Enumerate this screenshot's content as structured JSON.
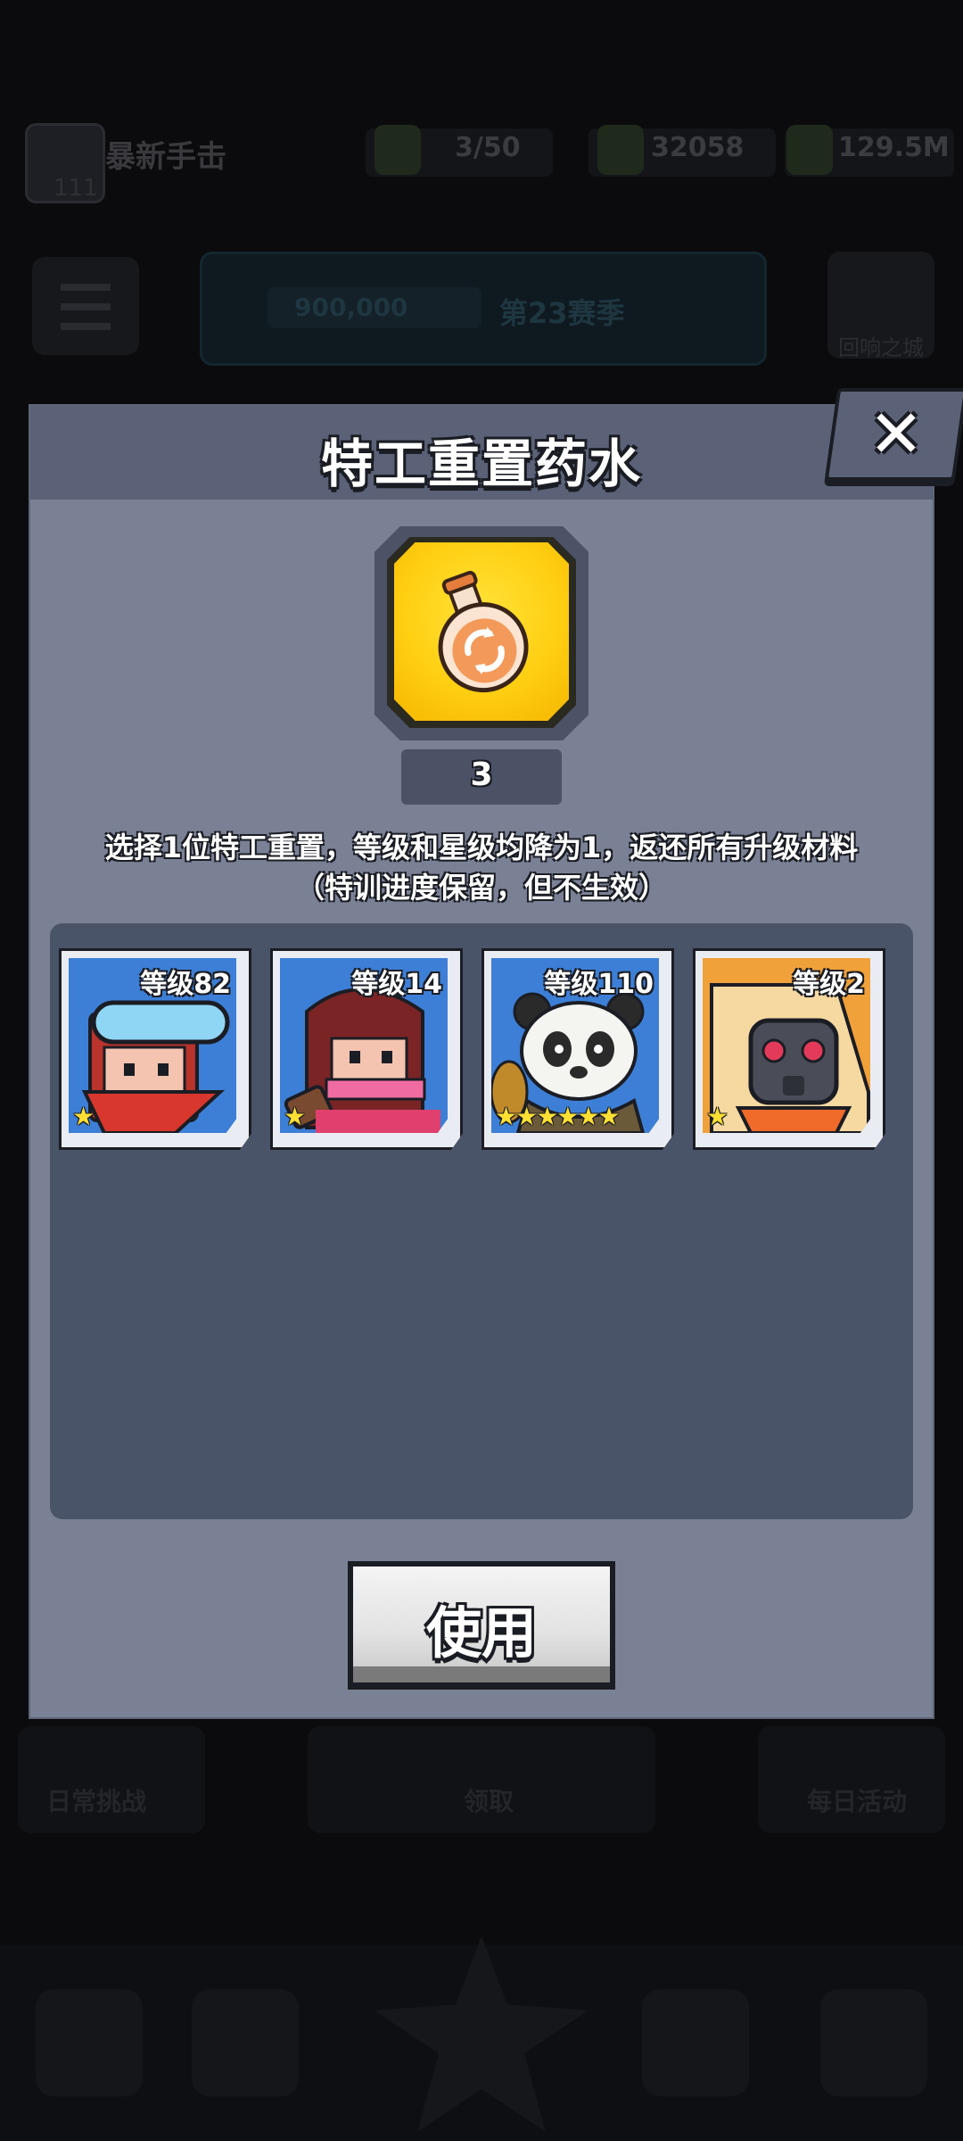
{
  "background": {
    "player_name": "暴新手击",
    "player_sub": "111",
    "res_stamina": "3/50",
    "res_gems": "32058",
    "res_gold": "129.5M",
    "banner_chip": "900,000",
    "banner_text": "第23赛季",
    "shield_label": "回响之城",
    "lower_left_label": "日常挑战",
    "lower_center_label": "领取",
    "lower_right_label": "每日活动"
  },
  "modal": {
    "title": "特工重置药水",
    "item_icon": "reset-potion-icon",
    "item_count": "3",
    "description_line1": "选择1位特工重置，等级和星级均降为1，返还所有升级材料",
    "description_line2": "（特训进度保留，但不生效）",
    "use_label": "使用",
    "close_icon": "close-icon"
  },
  "agents": [
    {
      "level": "等级82",
      "stars": 1,
      "portrait": "goggles-ninja-portrait"
    },
    {
      "level": "等级14",
      "stars": 1,
      "portrait": "red-hair-girl-portrait"
    },
    {
      "level": "等级110",
      "stars": 6,
      "portrait": "panda-portrait"
    },
    {
      "level": "等级2",
      "stars": 1,
      "portrait": "gasmask-hood-portrait"
    }
  ],
  "colors": {
    "modal_bg": "#7a8195",
    "header_bg": "#5b6277",
    "panel_bg": "#4a5468",
    "item_gold": "#ffcf12",
    "star": "#ffe033"
  }
}
